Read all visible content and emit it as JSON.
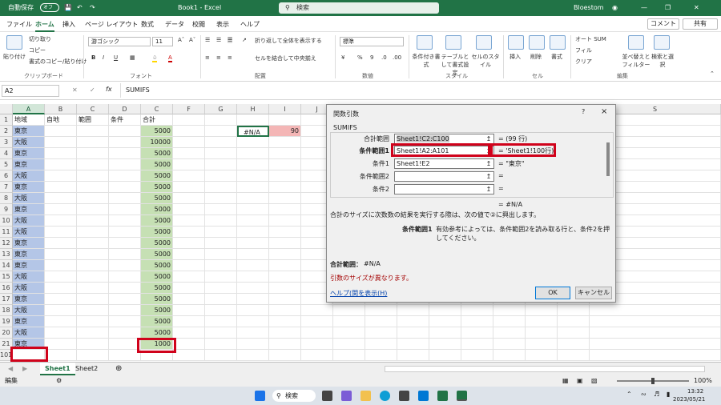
{
  "titlebar": {
    "autosave": "自動保存",
    "autosave_state": "オフ",
    "title": "Book1 - Excel",
    "search": "検索",
    "user": "Bloestom"
  },
  "menu": [
    "ファイル",
    "ホーム",
    "挿入",
    "ページ レイアウト",
    "数式",
    "データ",
    "校閲",
    "表示",
    "ヘルプ"
  ],
  "comment_btn": "コメント",
  "share_btn": "共有",
  "ribbon": {
    "paste": "貼り付け",
    "cut": "切り取り",
    "copy": "コピー",
    "format_painter": "書式のコピー/貼り付け",
    "clipboard": "クリップボード",
    "font_name": "游ゴシック",
    "font_size": "11",
    "font_group": "フォント",
    "wrap": "折り返して全体を表示する",
    "merge": "セルを結合して中央揃え",
    "align_group": "配置",
    "number_format": "標準",
    "number_group": "数値",
    "cond_format": "条件付き書式",
    "table_format": "テーブルとして書式設定",
    "cell_style": "セルのスタイル",
    "style_group": "スタイル",
    "insert": "挿入",
    "delete": "削除",
    "format": "書式",
    "cells_group": "セル",
    "autosum": "オート SUM",
    "fill": "フィル",
    "clear": "クリア",
    "sort": "並べ替えとフィルター",
    "find": "検索と選択",
    "edit_group": "編集"
  },
  "namebox": "A2",
  "formula": "SUMIFS",
  "columns": [
    "A",
    "B",
    "C",
    "D",
    "C",
    "F",
    "G",
    "H",
    "I",
    "J",
    "K",
    "L",
    "M",
    "N",
    "O",
    "P",
    "Q",
    "R",
    "S"
  ],
  "rows": [
    "1",
    "2",
    "3",
    "4",
    "5",
    "6",
    "7",
    "8",
    "9",
    "10",
    "11",
    "12",
    "13",
    "14",
    "15",
    "16",
    "17",
    "18",
    "19",
    "20",
    "21",
    "101"
  ],
  "headers": {
    "a": "地域",
    "b": "自地",
    "c": "範囲",
    "d": "条件",
    "e": "合計"
  },
  "regions": [
    "東京",
    "大阪",
    "東京",
    "東京",
    "大阪",
    "東京",
    "大阪",
    "東京",
    "大阪",
    "大阪",
    "東京",
    "東京",
    "東京",
    "大阪",
    "大阪",
    "東京",
    "大阪",
    "東京",
    "大阪",
    "東京"
  ],
  "totals": [
    "5000",
    "10000",
    "5000",
    "5000",
    "5000",
    "5000",
    "5000",
    "5000",
    "5000",
    "5000",
    "5000",
    "5000",
    "5000",
    "5000",
    "5000",
    "5000",
    "5000",
    "5000",
    "5000",
    "1000"
  ],
  "h2": "#N/A",
  "i2": "90",
  "sheets": [
    "Sheet1",
    "Sheet2"
  ],
  "status": {
    "mode": "編集",
    "zoom": "100%"
  },
  "taskbar": {
    "search": "検索",
    "time": "13:32",
    "date": "2023/05/21"
  },
  "dialog": {
    "title": "関数引数",
    "func": "SUMIFS",
    "args": [
      {
        "label": "合計範囲",
        "value": "Sheet1!C2:C100",
        "result": "= (99 行)"
      },
      {
        "label": "条件範囲1",
        "value": "Sheet1!A2:A101",
        "result": "= 'Sheet1!100行)"
      },
      {
        "label": "条件1",
        "value": "Sheet1!E2",
        "result": "= \"東京\""
      },
      {
        "label": "条件範囲2",
        "value": "",
        "result": "="
      },
      {
        "label": "条件2",
        "value": "",
        "result": "="
      }
    ],
    "eq_result": "= #N/A",
    "description": "合計のサイズに次数数の結果を実行する際は、次の値で②に興出します。",
    "arg_name": "条件範囲1",
    "arg_desc": "有効参考によっては、条件範囲2を読み取る行と、条件2を押してください。",
    "formula_result_label": "合計範囲：",
    "formula_result": "#N/A",
    "error": "引数のサイズが異なります。",
    "help": "ヘルプ(関を表示(H)",
    "ok": "OK",
    "cancel": "キャンセル",
    "help_q": "?",
    "close": "×"
  },
  "colors": {
    "excel_green": "#217346",
    "region_fill": "#b4c6e7",
    "total_fill": "#c6e0b4",
    "error_fill": "#f4b6b6",
    "highlight": "#d0021b"
  }
}
